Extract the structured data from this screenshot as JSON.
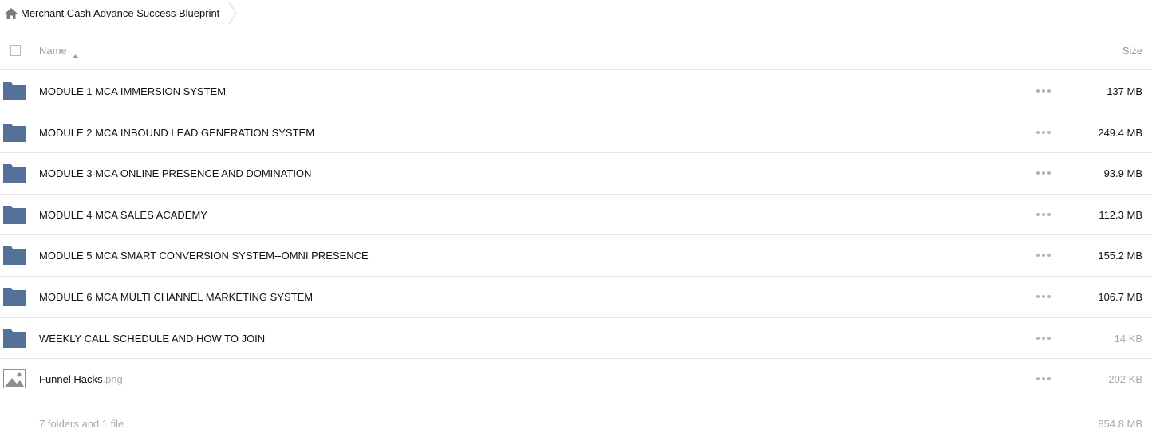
{
  "breadcrumb": {
    "title": "Merchant Cash Advance Success Blueprint"
  },
  "header": {
    "name_label": "Name",
    "size_label": "Size"
  },
  "rows": [
    {
      "name": "MODULE 1 MCA IMMERSION SYSTEM",
      "ext": "",
      "size": "137 MB",
      "type": "folder",
      "dim_size": false
    },
    {
      "name": "MODULE 2 MCA INBOUND LEAD GENERATION SYSTEM",
      "ext": "",
      "size": "249.4 MB",
      "type": "folder",
      "dim_size": false
    },
    {
      "name": "MODULE 3 MCA ONLINE PRESENCE AND DOMINATION",
      "ext": "",
      "size": "93.9 MB",
      "type": "folder",
      "dim_size": false
    },
    {
      "name": "MODULE 4 MCA SALES ACADEMY",
      "ext": "",
      "size": "112.3 MB",
      "type": "folder",
      "dim_size": false
    },
    {
      "name": "MODULE 5 MCA SMART CONVERSION SYSTEM--OMNI PRESENCE",
      "ext": "",
      "size": "155.2 MB",
      "type": "folder",
      "dim_size": false
    },
    {
      "name": "MODULE 6 MCA MULTI CHANNEL MARKETING SYSTEM",
      "ext": "",
      "size": "106.7 MB",
      "type": "folder",
      "dim_size": false
    },
    {
      "name": "WEEKLY CALL SCHEDULE AND HOW TO JOIN",
      "ext": "",
      "size": "14 KB",
      "type": "folder",
      "dim_size": true
    },
    {
      "name": "Funnel Hacks",
      "ext": ".png",
      "size": "202 KB",
      "type": "image",
      "dim_size": true
    }
  ],
  "footer": {
    "summary": "7 folders and 1 file",
    "total": "854.8 MB"
  },
  "colors": {
    "folder": "#55719a",
    "image_icon": "#8f8f8f",
    "muted_text": "#aaaaaa"
  }
}
